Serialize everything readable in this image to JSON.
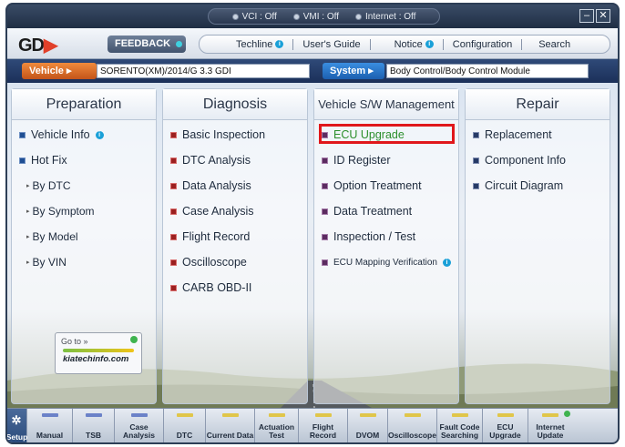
{
  "status": {
    "vci": "VCI : Off",
    "vmi": "VMI : Off",
    "internet": "Internet : Off"
  },
  "window_buttons": {
    "minimize": "–",
    "close": "✕"
  },
  "nav": {
    "logo_text": "GD",
    "feedback": "FEEDBACK",
    "menu": [
      "Techline",
      "User's Guide",
      "Notice",
      "Configuration",
      "Search"
    ]
  },
  "vehicle_bar": {
    "vehicle_label": "Vehicle",
    "vehicle_value": "SORENTO(XM)/2014/G 3.3 GDI",
    "system_label": "System",
    "system_value": "Body Control/Body Control Module"
  },
  "columns": {
    "preparation": {
      "title": "Preparation",
      "items": [
        "Vehicle Info",
        "Hot Fix",
        "By DTC",
        "By Symptom",
        "By Model",
        "By VIN"
      ]
    },
    "diagnosis": {
      "title": "Diagnosis",
      "items": [
        "Basic Inspection",
        "DTC Analysis",
        "Data Analysis",
        "Case Analysis",
        "Flight Record",
        "Oscilloscope",
        "CARB OBD-II"
      ]
    },
    "vehicle_sw": {
      "title": "Vehicle S/W Management",
      "items": [
        "ECU Upgrade",
        "ID Register",
        "Option Treatment",
        "Data Treatment",
        "Inspection / Test",
        "ECU Mapping Verification"
      ]
    },
    "repair": {
      "title": "Repair",
      "items": [
        "Replacement",
        "Component Info",
        "Circuit Diagram"
      ]
    }
  },
  "goto_badge": {
    "label": "Go to »",
    "site": "kiatechinfo.com"
  },
  "toolbar": {
    "setup": "Setup",
    "items": [
      "Manual",
      "TSB",
      "Case Analysis",
      "DTC",
      "Current Data",
      "Actuation Test",
      "Flight Record",
      "DVOM",
      "Oscilloscope",
      "Fault Code Searching",
      "ECU Upgrade",
      "Internet Update"
    ]
  },
  "colors": {
    "accent_orange": "#e1402a",
    "highlight_red": "#e0171b",
    "link_green": "#2c8f2c",
    "info_blue": "#1aa0d8"
  }
}
